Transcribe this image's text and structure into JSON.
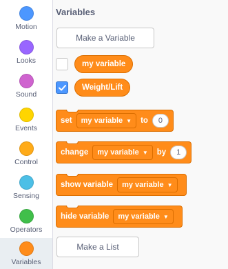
{
  "categories": [
    {
      "label": "Motion",
      "color": "#4c97ff"
    },
    {
      "label": "Looks",
      "color": "#9966ff"
    },
    {
      "label": "Sound",
      "color": "#cf63cf"
    },
    {
      "label": "Events",
      "color": "#ffd500"
    },
    {
      "label": "Control",
      "color": "#ffab19"
    },
    {
      "label": "Sensing",
      "color": "#4cbfe6"
    },
    {
      "label": "Operators",
      "color": "#40bf4a"
    },
    {
      "label": "Variables",
      "color": "#ff8c1a"
    }
  ],
  "selected_category": "Variables",
  "palette": {
    "section_title": "Variables",
    "make_variable_label": "Make a Variable",
    "make_list_label": "Make a List",
    "variables": [
      {
        "name": "my variable",
        "checked": false
      },
      {
        "name": "Weight/Lift",
        "checked": true
      }
    ],
    "blocks": {
      "set": {
        "word": "set",
        "dropdown": "my variable",
        "word2": "to",
        "value": "0"
      },
      "change": {
        "word": "change",
        "dropdown": "my variable",
        "word2": "by",
        "value": "1"
      },
      "show": {
        "word": "show variable",
        "dropdown": "my variable"
      },
      "hide": {
        "word": "hide variable",
        "dropdown": "my variable"
      }
    }
  },
  "colors": {
    "variables_block": "#ff8c1a",
    "checkbox_checked": "#4c97ff"
  }
}
